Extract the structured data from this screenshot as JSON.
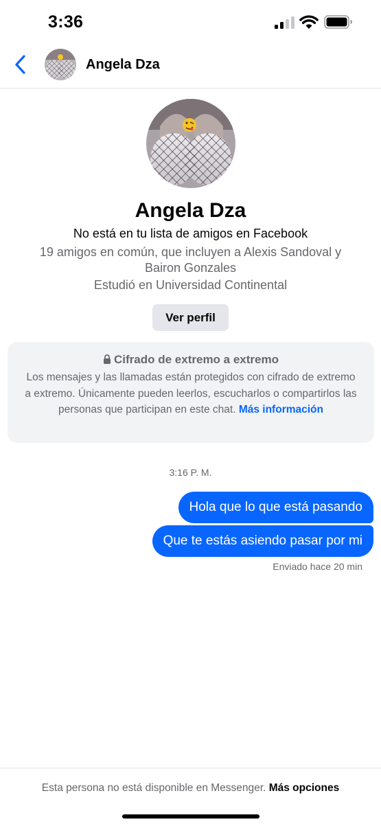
{
  "status_bar": {
    "time": "3:36",
    "signal_icon": "cellular-signal-icon",
    "wifi_icon": "wifi-icon",
    "battery_icon": "battery-icon"
  },
  "header": {
    "back_icon": "chevron-left-icon",
    "name": "Angela Dza"
  },
  "profile": {
    "name": "Angela Dza",
    "friend_status": "No está en tu lista de amigos en Facebook",
    "mutual_friends": "19 amigos en común, que incluyen a Alexis Sandoval y Bairon Gonzales",
    "education": "Estudió en Universidad Continental",
    "view_profile_label": "Ver perfil"
  },
  "encryption": {
    "icon": "lock-icon",
    "title": "Cifrado de extremo a extremo",
    "body": "Los mensajes y las llamadas están protegidos con cifrado de extremo a extremo. Únicamente pueden leerlos, escucharlos o compartirlos las personas que participan en este chat.",
    "link": "Más información"
  },
  "conversation": {
    "timestamp": "3:16 P. M.",
    "messages": [
      {
        "text": "Hola que lo que está pasando",
        "sender": "me"
      },
      {
        "text": "Que te estás asiendo pasar por mi",
        "sender": "me"
      }
    ],
    "sent_status": "Enviado hace 20 min"
  },
  "footer": {
    "notice": "Esta persona no está disponible en Messenger.",
    "more_options": "Más opciones"
  },
  "colors": {
    "accent": "#0866ff",
    "secondary_text": "#65676b",
    "card_bg": "#f2f3f5",
    "button_bg": "#e4e6eb"
  }
}
